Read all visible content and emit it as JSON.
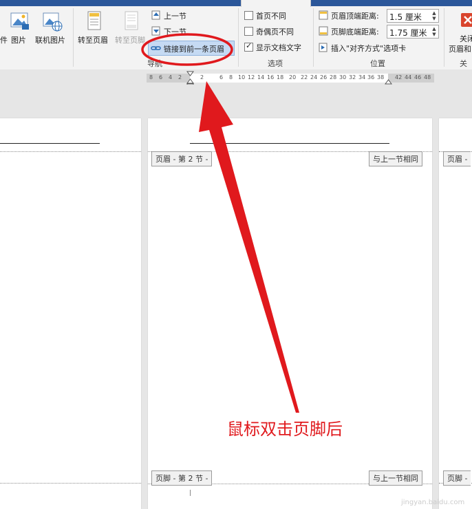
{
  "ribbon": {
    "insert_group": {
      "partial_label": "件",
      "picture_label": "图片",
      "online_picture_label": "联机图片"
    },
    "navigation": {
      "goto_header_label": "转至页眉",
      "goto_footer_label": "转至页脚",
      "previous_section_label": "上一节",
      "next_section_label": "下一节",
      "link_to_previous_label": "链接到前一条页眉",
      "group_label": "导航"
    },
    "options": {
      "different_first_page_label": "首页不同",
      "different_odd_even_label": "奇偶页不同",
      "show_document_text_label": "显示文档文字",
      "show_document_text_checked": true,
      "group_label": "选项"
    },
    "position": {
      "header_from_top_label": "页眉顶端距离:",
      "header_from_top_value": "1.5 厘米",
      "footer_from_bottom_label": "页脚底端距离:",
      "footer_from_bottom_value": "1.75 厘米",
      "insert_alignment_tab_label": "插入\"对齐方式\"选项卡",
      "group_label": "位置"
    },
    "close": {
      "close_label_line1": "关闭",
      "close_label_line2": "页眉和",
      "group_label": "关闭"
    }
  },
  "ruler": {
    "ticks": [
      "8",
      "6",
      "4",
      "2",
      "2",
      "6",
      "8",
      "10",
      "12",
      "14",
      "16",
      "18",
      "20",
      "22",
      "24",
      "26",
      "28",
      "30",
      "32",
      "34",
      "36",
      "38",
      "42",
      "44",
      "46",
      "48"
    ]
  },
  "document": {
    "header_tag": "页眉 - 第 2 节 -",
    "same_as_previous_tag": "与上一节相同",
    "footer_tag": "页脚 - 第 2 节 -",
    "footer_same_as_previous_tag": "与上一节相同",
    "right_header_tag": "页眉 -",
    "right_footer_tag": "页脚 -"
  },
  "annotation": {
    "text": "鼠标双击页脚后",
    "color": "#e0191d"
  },
  "watermark": {
    "text": "jingyan.baidu.com"
  }
}
